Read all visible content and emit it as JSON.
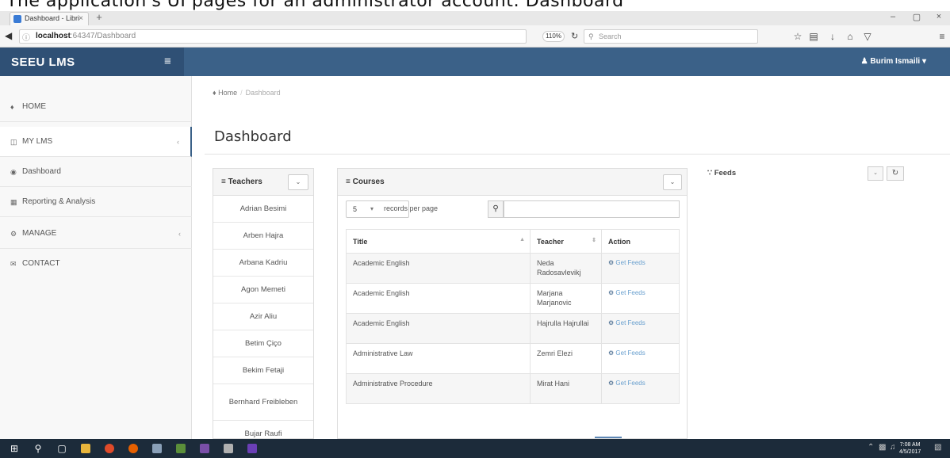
{
  "caption": "The application's UI pages for an administrator account: Dashboard",
  "browser": {
    "tab_title": "Dashboard - Libri",
    "tab_close": "×",
    "new_tab": "+",
    "window_controls": [
      "–",
      "▢",
      "×"
    ],
    "url_host": "localhost",
    "url_rest": ":64347/Dashboard",
    "zoom": "110%",
    "search_placeholder": "Search"
  },
  "app": {
    "brand": "SEEU LMS",
    "user": "Burim Ismaili",
    "user_caret": "▾"
  },
  "sidebar": {
    "items": [
      {
        "label": "HOME",
        "icon": "home-icon",
        "chevron": ""
      },
      {
        "label": "MY LMS",
        "icon": "folder-icon",
        "chevron": "‹"
      },
      {
        "label": "Dashboard",
        "icon": "dashboard-icon",
        "chevron": ""
      },
      {
        "label": "Reporting & Analysis",
        "icon": "chart-icon",
        "chevron": ""
      },
      {
        "label": "MANAGE",
        "icon": "settings-icon",
        "chevron": "‹"
      },
      {
        "label": "CONTACT",
        "icon": "mail-icon",
        "chevron": ""
      }
    ]
  },
  "breadcrumb": {
    "home": "Home",
    "current": "Dashboard"
  },
  "page_title": "Dashboard",
  "teachers": {
    "title": "Teachers",
    "list": [
      "Adrian Besimi",
      "Arben Hajra",
      "Arbana Kadriu",
      "Agon Memeti",
      "Azir Aliu",
      "Betim Çiço",
      "Bekim Fetaji",
      "Bernhard Freibleben",
      "Bujar Raufi"
    ]
  },
  "courses": {
    "title": "Courses",
    "records_per_page_value": "5",
    "records_per_page_label": "records per page",
    "columns": [
      "Title",
      "Teacher",
      "Action"
    ],
    "action_label": "Get Feeds",
    "rows": [
      {
        "title": "Academic English",
        "teacher": "Neda Radosavlevikj"
      },
      {
        "title": "Academic English",
        "teacher": "Marjana Marjanovic"
      },
      {
        "title": "Academic English",
        "teacher": "Hajrulla Hajrullai"
      },
      {
        "title": "Administrative Law",
        "teacher": "Zemri Elezi"
      },
      {
        "title": "Administrative Procedure",
        "teacher": "Mirat Hani"
      }
    ]
  },
  "feeds": {
    "title": "Feeds"
  },
  "taskbar": {
    "time": "7:08 AM",
    "date": "4/5/2017"
  },
  "colors": {
    "header": "#3b6188",
    "brand_bg": "#2f5075",
    "taskbar": "#1c2b3a"
  }
}
